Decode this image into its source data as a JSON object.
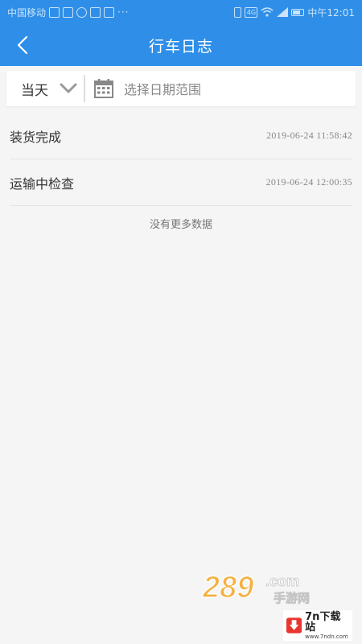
{
  "status_bar": {
    "carrier": "中国移动",
    "dots": "···",
    "network": "4G",
    "time": "中午12:01"
  },
  "header": {
    "title": "行车日志"
  },
  "filter": {
    "day_option": "当天",
    "date_placeholder": "选择日期范围"
  },
  "logs": [
    {
      "title": "装货完成",
      "time": "2019-06-24 11:58:42"
    },
    {
      "title": "运输中检查",
      "time": "2019-06-24 12:00:35"
    }
  ],
  "footer": {
    "no_more": "没有更多数据"
  },
  "watermarks": {
    "brand_289": "289",
    "brand_289_domain": ".com",
    "brand_289_sub": "手游网",
    "brand_7n": "7n下载站",
    "brand_7n_url": "www.7ndn.com"
  },
  "colors": {
    "primary": "#2f8fe8",
    "background": "#f5f5f5",
    "text_primary": "#333333",
    "text_secondary": "#888888"
  }
}
